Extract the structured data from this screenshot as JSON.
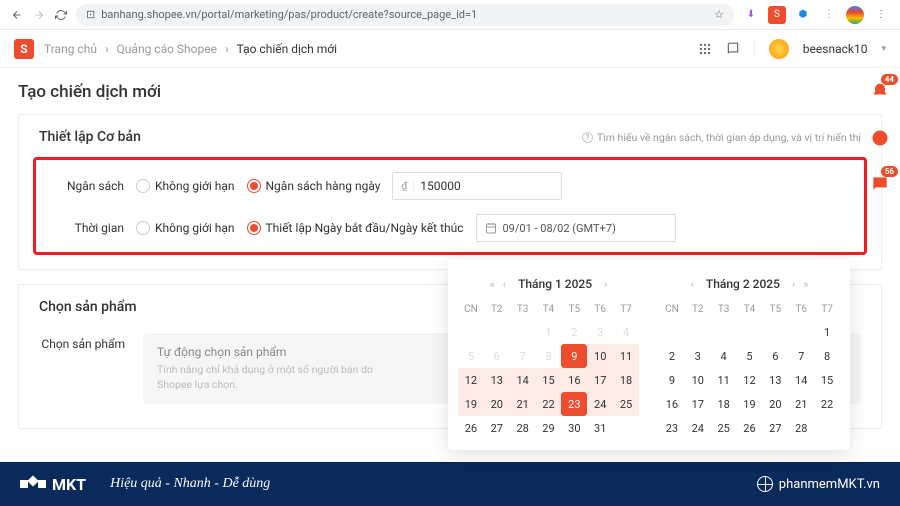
{
  "browser": {
    "url": "banhang.shopee.vn/portal/marketing/pas/product/create?source_page_id=1"
  },
  "header": {
    "breadcrumb": [
      "Trang chủ",
      "Quảng cáo Shopee",
      "Tạo chiến dịch mới"
    ],
    "username": "beesnack10"
  },
  "page_title": "Tạo chiến dịch mới",
  "card_basic": {
    "title": "Thiết lập Cơ bản",
    "hint": "Tìm hiểu về ngân sách, thời gian áp dụng, và vị trí hiển thị",
    "budget": {
      "label": "Ngân sách",
      "opt_unlimited": "Không giới hạn",
      "opt_daily": "Ngân sách hàng ngày",
      "currency": "₫",
      "value": "150000"
    },
    "time": {
      "label": "Thời gian",
      "opt_unlimited": "Không giới hạn",
      "opt_range": "Thiết lập Ngày bắt đầu/Ngày kết thúc",
      "value": "09/01 - 08/02 (GMT+7)"
    }
  },
  "card_product": {
    "title": "Chọn sản phẩm",
    "label": "Chọn sản phẩm",
    "auto_title": "Tự động chọn sản phẩm",
    "auto_desc": "Tính năng chỉ khả dụng ở một số người bán do Shopee lựa chọn."
  },
  "calendar": {
    "month1_title": "Tháng 1 2025",
    "month2_title": "Tháng 2 2025",
    "dow": [
      "CN",
      "T2",
      "T3",
      "T4",
      "T5",
      "T6",
      "T7"
    ],
    "month1_days": [
      [
        "",
        "",
        "",
        "1",
        "2",
        "3",
        "4"
      ],
      [
        "5",
        "6",
        "7",
        "8",
        "9",
        "10",
        "11"
      ],
      [
        "12",
        "13",
        "14",
        "15",
        "16",
        "17",
        "18"
      ],
      [
        "19",
        "20",
        "21",
        "22",
        "23",
        "24",
        "25"
      ],
      [
        "26",
        "27",
        "28",
        "29",
        "30",
        "31",
        ""
      ]
    ],
    "month2_days": [
      [
        "",
        "",
        "",
        "",
        "",
        "",
        "1"
      ],
      [
        "2",
        "3",
        "4",
        "5",
        "6",
        "7",
        "8"
      ],
      [
        "9",
        "10",
        "11",
        "12",
        "13",
        "14",
        "15"
      ],
      [
        "16",
        "17",
        "18",
        "19",
        "20",
        "21",
        "22"
      ],
      [
        "23",
        "24",
        "25",
        "26",
        "27",
        "28",
        ""
      ]
    ],
    "m1_sel": [
      9,
      23
    ],
    "m1_range": [
      9,
      25
    ]
  },
  "badges": {
    "b1": "44",
    "b2": "56"
  },
  "footer": {
    "brand": "MKT",
    "slogan": "Hiệu quả - Nhanh - Dễ dùng",
    "site": "phanmemMKT.vn"
  }
}
